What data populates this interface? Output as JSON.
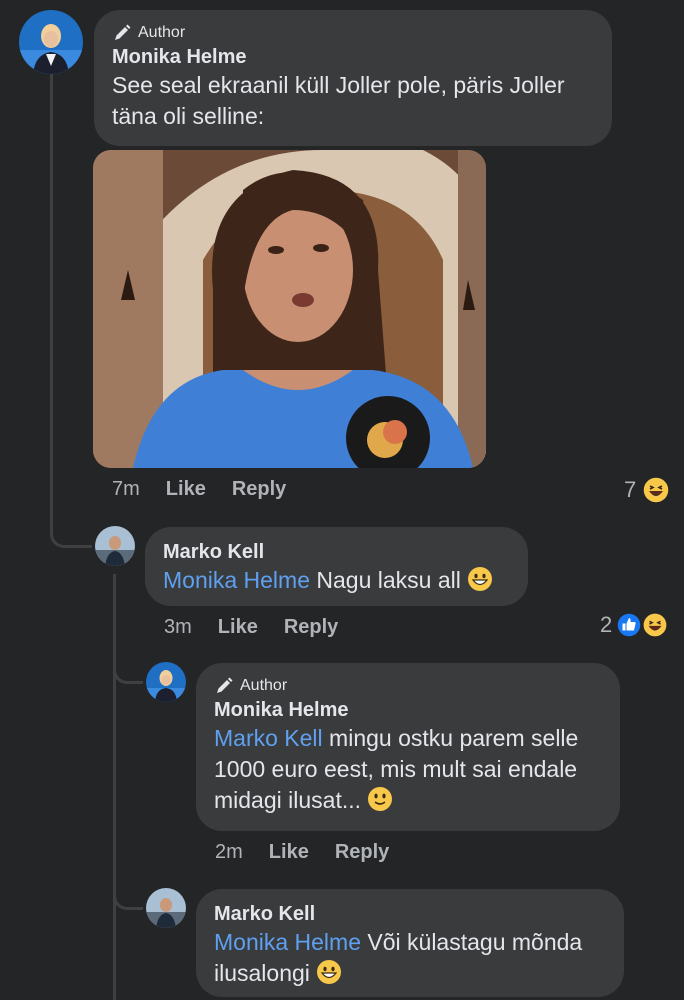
{
  "comment1": {
    "badge": "Author",
    "name": "Monika Helme",
    "text_line1": "See seal ekraanil küll Joller pole, päris Joller",
    "text_line2": "täna oli selline:",
    "time": "7m",
    "like": "Like",
    "reply": "Reply",
    "reaction_count": "7"
  },
  "comment2": {
    "name": "Marko Kell",
    "mention": "Monika Helme",
    "text": " Nagu laksu all",
    "time": "3m",
    "like": "Like",
    "reply": "Reply",
    "reaction_count": "2"
  },
  "comment3": {
    "badge": "Author",
    "name": "Monika Helme",
    "mention": "Marko Kell",
    "text_line1": " mingu ostku parem selle",
    "text_line2": "1000 euro eest, mis mult sai endale",
    "text_line3": "midagi ilusat...",
    "time": "2m",
    "like": "Like",
    "reply": "Reply"
  },
  "comment4": {
    "name": "Marko Kell",
    "mention": "Monika Helme",
    "text_line1": " Või külastagu mõnda",
    "text_line2": "ilusalongi"
  },
  "colors": {
    "background": "#242526",
    "bubble": "#3a3b3c",
    "mention": "#5fa0f0",
    "muted": "#b0b3b8"
  }
}
